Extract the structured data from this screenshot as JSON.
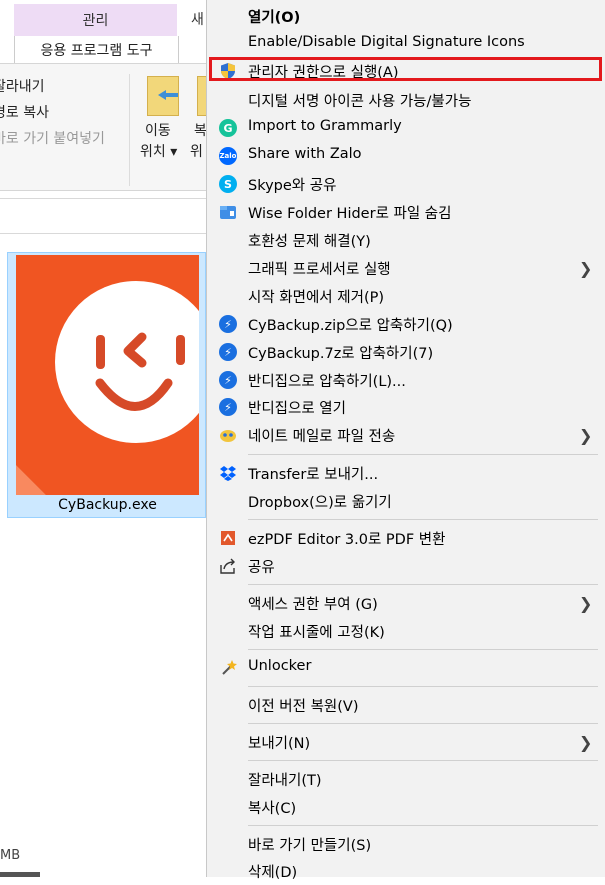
{
  "explorer": {
    "tab_manage": "관리",
    "tab_new": "새",
    "tab_app_tools": "응용 프로그램 도구",
    "ribbon": {
      "cut": "잘라내기",
      "copy_path": "경로 복사",
      "paste_shortcut": "바로 가기 붙여넣기",
      "move_label": "이동",
      "move_sub": "위치",
      "copy_label": "복",
      "copy_sub": "위"
    },
    "file_name": "CyBackup.exe",
    "status_size": "MB"
  },
  "context_menu": {
    "items": [
      {
        "label": "열기(O)",
        "bold": true,
        "icon": "none"
      },
      {
        "label": "Enable/Disable Digital Signature Icons",
        "icon": "none"
      },
      {
        "label": "관리자 권한으로 실행(A)",
        "icon": "uac-shield-icon"
      },
      {
        "label": "디지털 서명 아이콘 사용 가능/불가능",
        "icon": "none"
      },
      {
        "label": "Import to Grammarly",
        "icon": "grammarly-icon"
      },
      {
        "label": "Share with Zalo",
        "icon": "zalo-icon"
      },
      {
        "label": "Skype와 공유",
        "icon": "skype-icon"
      },
      {
        "label": "Wise Folder Hider로 파일 숨김",
        "icon": "wise-folder-hider-icon"
      },
      {
        "label": "호환성 문제 해결(Y)",
        "icon": "none"
      },
      {
        "label": "그래픽 프로세서로 실행",
        "icon": "none",
        "submenu": true
      },
      {
        "label": "시작 화면에서 제거(P)",
        "icon": "none"
      },
      {
        "label": "CyBackup.zip으로 압축하기(Q)",
        "icon": "bandizip-icon"
      },
      {
        "label": "CyBackup.7z로 압축하기(7)",
        "icon": "bandizip-icon"
      },
      {
        "label": "반디집으로 압축하기(L)...",
        "icon": "bandizip-icon"
      },
      {
        "label": "반디집으로 열기",
        "icon": "bandizip-icon"
      },
      {
        "label": "네이트 메일로 파일 전송",
        "icon": "nate-mail-icon",
        "submenu": true
      },
      {
        "label": "Transfer로 보내기...",
        "icon": "dropbox-icon"
      },
      {
        "label": "Dropbox(으)로 옮기기",
        "icon": "none"
      },
      {
        "label": "ezPDF Editor 3.0로 PDF 변환",
        "icon": "ezpdf-icon"
      },
      {
        "label": "공유",
        "icon": "share-icon"
      },
      {
        "label": "액세스 권한 부여 (G)",
        "icon": "none",
        "submenu": true
      },
      {
        "label": "작업 표시줄에 고정(K)",
        "icon": "none"
      },
      {
        "label": "Unlocker",
        "icon": "unlocker-wand-icon"
      },
      {
        "label": "이전 버전 복원(V)",
        "icon": "none"
      },
      {
        "label": "보내기(N)",
        "icon": "none",
        "submenu": true
      },
      {
        "label": "잘라내기(T)",
        "icon": "none"
      },
      {
        "label": "복사(C)",
        "icon": "none"
      },
      {
        "label": "바로 가기 만들기(S)",
        "icon": "none"
      },
      {
        "label": "삭제(D)",
        "icon": "none"
      }
    ],
    "highlighted_item": "관리자 권한으로 실행(A)"
  },
  "colors": {
    "menu_bg": "#f2f2f2",
    "highlight_border": "#e3191d",
    "app_icon_orange": "#f05522",
    "selection_bg": "#cce8ff"
  }
}
